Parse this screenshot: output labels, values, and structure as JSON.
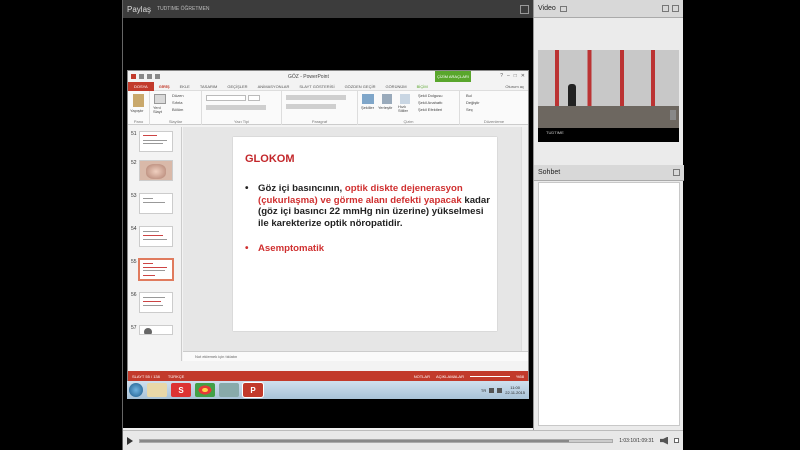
{
  "session": {
    "share_label": "Paylaş",
    "presenter": "TUDTIME ÖĞRETMEN"
  },
  "ppt": {
    "doc_title": "GÖZ - PowerPoint",
    "contextual_tab": "ÇİZİM ARAÇLARI",
    "tabs": [
      "DOSYA",
      "GİRİŞ",
      "EKLE",
      "TASARIM",
      "GEÇİŞLER",
      "ANİMASYONLAR",
      "SLAYT GÖSTERİSİ",
      "GÖZDEN GEÇİR",
      "GÖRÜNÜM",
      "BİÇİM"
    ],
    "active_tab": "GİRİŞ",
    "user": "Oturum aç",
    "ribbon": {
      "clipboard": "Pano",
      "paste": "Yapıştır",
      "slides_group": "Slaytlar",
      "new_slide": "Yeni Slayt",
      "layout": "Düzen",
      "reset": "Sıfırla",
      "section": "Bölüm",
      "font": "Yazı Tipi",
      "paragraph": "Paragraf",
      "drawing": "Çizim",
      "shapes": "Şekiller",
      "arrange": "Yerleştir",
      "quick_styles": "Hızlı Stiller",
      "shape_fill": "Şekil Dolgusu",
      "shape_outline": "Şekil Anahattı",
      "shape_effects": "Şekil Efektleri",
      "editing": "Düzenleme",
      "find": "Bul",
      "replace": "Değiştir",
      "select": "Seç"
    },
    "thumbnails": [
      {
        "num": "51"
      },
      {
        "num": "52"
      },
      {
        "num": "53"
      },
      {
        "num": "54"
      },
      {
        "num": "55"
      },
      {
        "num": "56"
      },
      {
        "num": "57"
      }
    ],
    "selected_slide": "55",
    "slide": {
      "title": "GLOKOM",
      "b1_text1": "Göz içi basıncının, ",
      "b1_red": "optik diskte dejenerasyon (çukurlaşma) ve görme alanı defekti yapacak",
      "b1_text2": " kadar (göz içi basıncı 22 mmHg nin üzerine) yükselmesi ile karekterize optik nöropatidir.",
      "b2": "Asemptomatik"
    },
    "notes_placeholder": "Not eklemek için tıklatın",
    "status": {
      "slide_info": "SLAYT 55 / 138",
      "language": "TÜRKÇE",
      "notes": "NOTLAR",
      "comments": "AÇIKLAMALAR",
      "zoom": "%58"
    }
  },
  "taskbar": {
    "lang": "TR",
    "time": "11:00",
    "date": "22.11.2015"
  },
  "playback": {
    "time": "1:03:10/1:09:31",
    "progress": 0.909
  },
  "right_panel": {
    "video_title": "Video",
    "video_caption": "TUDTIME",
    "chat_title": "Sohbet"
  },
  "colors": {
    "accent_red": "#c23a2b",
    "slide_title": "#c3272b",
    "highlight_text": "#d03030"
  }
}
